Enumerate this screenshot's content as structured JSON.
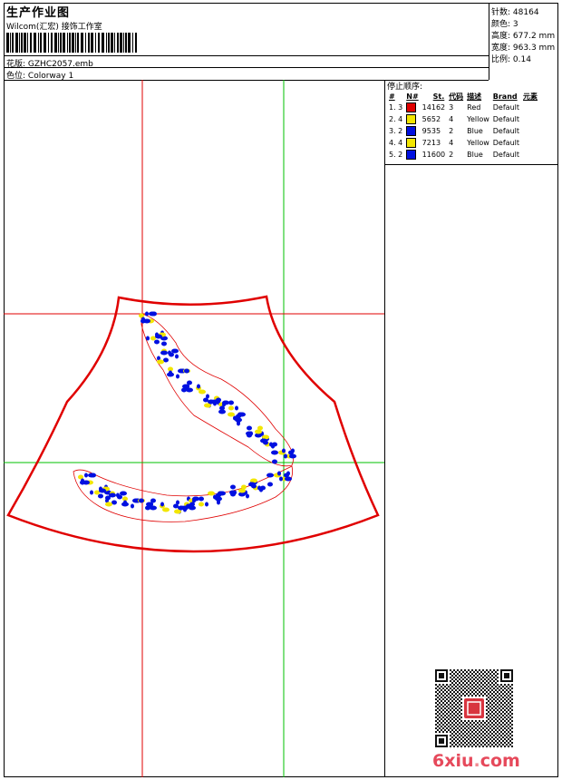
{
  "header": {
    "title": "生产作业图",
    "company": "Wilcom(汇宏) 接饰工作室",
    "design_label": "花版:",
    "design_value": "GZHC2057.emb",
    "colorway_label": "色位:",
    "colorway_value": "Colorway 1"
  },
  "stats": [
    {
      "label": "针数:",
      "value": "48164"
    },
    {
      "label": "颜色:",
      "value": "3"
    },
    {
      "label": "高度:",
      "value": "677.2 mm"
    },
    {
      "label": "宽度:",
      "value": "963.3 mm"
    },
    {
      "label": "比例:",
      "value": "0.14"
    }
  ],
  "stop_sequence": {
    "title": "停止顺序:",
    "columns": [
      "#",
      "N#",
      "St.",
      "代码",
      "描述",
      "Brand",
      "元素"
    ],
    "rows": [
      {
        "num": "1. 3",
        "color": "#e00000",
        "stitches": "14162",
        "code": "3",
        "desc": "Red",
        "brand": "Default"
      },
      {
        "num": "2. 4",
        "color": "#f2e600",
        "stitches": "5652",
        "code": "4",
        "desc": "Yellow",
        "brand": "Default"
      },
      {
        "num": "3. 2",
        "color": "#0010e0",
        "stitches": "9535",
        "code": "2",
        "desc": "Blue",
        "brand": "Default"
      },
      {
        "num": "4. 4",
        "color": "#f2e600",
        "stitches": "7213",
        "code": "4",
        "desc": "Yellow",
        "brand": "Default"
      },
      {
        "num": "5. 2",
        "color": "#0010e0",
        "stitches": "11600",
        "code": "2",
        "desc": "Blue",
        "brand": "Default"
      }
    ]
  },
  "watermark": {
    "logo_main": "6xiu",
    "logo_dot": ".",
    "logo_tld": "com"
  },
  "colors": {
    "red_line": "#e00000",
    "green_line": "#00c000",
    "embroidery_blue": "#0010e0",
    "embroidery_yellow": "#f2e600"
  }
}
